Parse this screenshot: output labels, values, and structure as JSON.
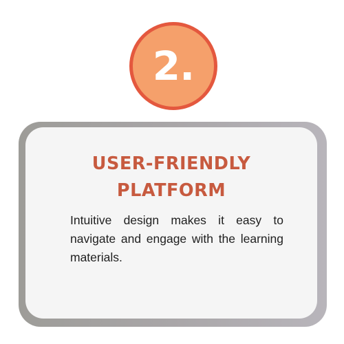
{
  "badge": {
    "number": "2."
  },
  "card": {
    "title_line1": "USER-FRIENDLY",
    "title_line2": "PLATFORM",
    "body": "Intuitive design makes it easy to navigate and engage with the learning materials."
  },
  "colors": {
    "badge_fill": "#f5a06b",
    "badge_border": "#e4583e",
    "title": "#c75a3f",
    "card_frame": "#a9a6a8",
    "card_fill": "#f5f5f5",
    "body_text": "#1f1f1f"
  }
}
